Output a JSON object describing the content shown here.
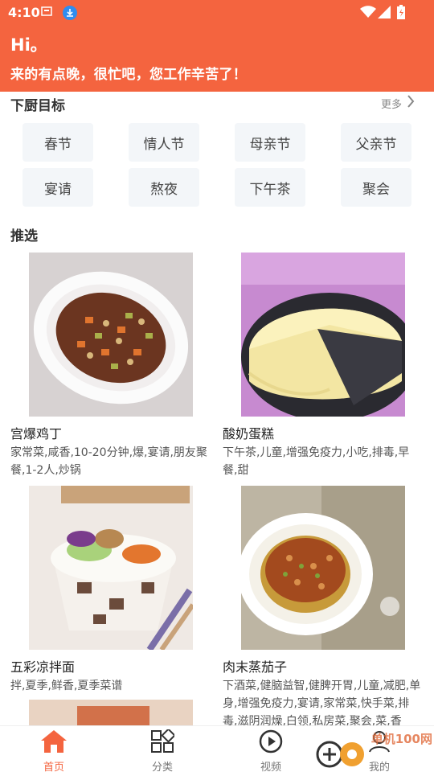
{
  "status_bar": {
    "time": "4:10"
  },
  "header": {
    "hi": "Hi。",
    "greeting": "来的有点晚，很忙吧，您工作辛苦了！"
  },
  "goals": {
    "title": "下厨目标",
    "more": "更多",
    "tags": [
      "春节",
      "情人节",
      "母亲节",
      "父亲节",
      "宴请",
      "熬夜",
      "下午茶",
      "聚会"
    ]
  },
  "recommend": {
    "title": "推选",
    "items": [
      {
        "title": "宫爆鸡丁",
        "desc": "家常菜,咸香,10-20分钟,爆,宴请,朋友聚餐,1-2人,炒锅"
      },
      {
        "title": "酸奶蛋糕",
        "desc": "下午茶,儿童,增强免疫力,小吃,排毒,早餐,甜"
      },
      {
        "title": "五彩凉拌面",
        "desc": "拌,夏季,鲜香,夏季菜谱"
      },
      {
        "title": "肉末蒸茄子",
        "desc": "下酒菜,健脑益智,健脾开胃,儿童,减肥,单身,增强免疫力,宴请,家常菜,快手菜,排毒,滋阴润燥,白领,私房菜,聚会,菜,香"
      }
    ]
  },
  "tabbar": {
    "tabs": [
      {
        "label": "首页",
        "icon": "home-icon",
        "active": true
      },
      {
        "label": "分类",
        "icon": "category-icon",
        "active": false
      },
      {
        "label": "视频",
        "icon": "video-play-icon",
        "active": false
      },
      {
        "label": "我的",
        "icon": "profile-icon",
        "active": false
      }
    ]
  },
  "watermark": "单机100网",
  "colors": {
    "accent": "#f4643f",
    "tag_bg": "#f3f6f9"
  }
}
